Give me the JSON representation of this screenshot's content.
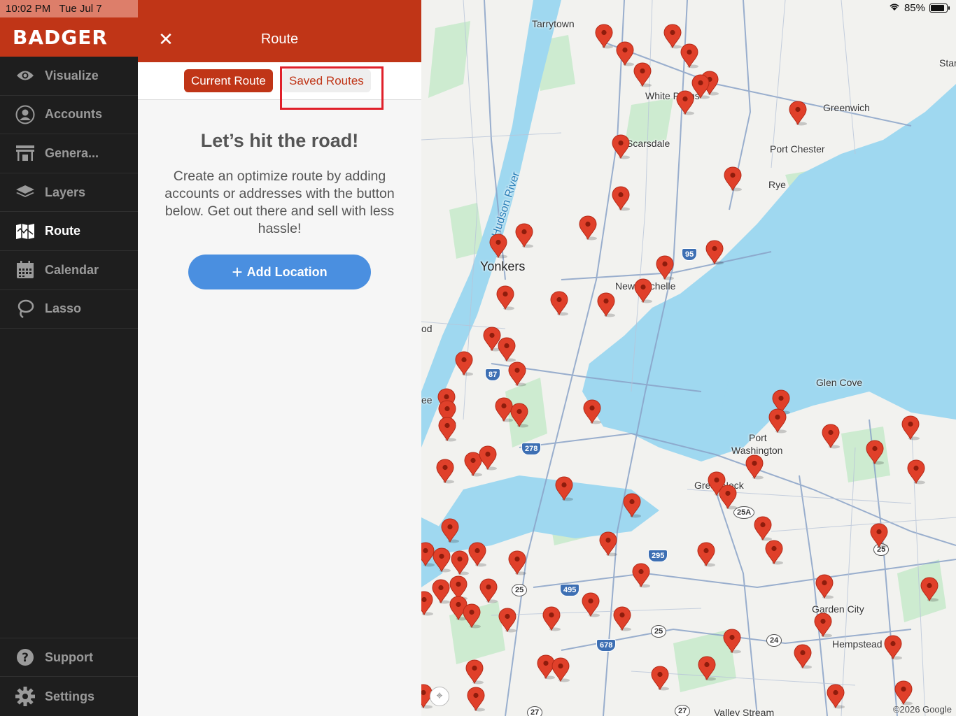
{
  "status_bar": {
    "time": "10:02 PM",
    "date": "Tue Jul 7",
    "battery": "85%"
  },
  "brand": {
    "name": "BADGER"
  },
  "sidebar": {
    "items": [
      {
        "label": "Visualize",
        "icon": "eye-icon"
      },
      {
        "label": "Accounts",
        "icon": "user-circle-icon"
      },
      {
        "label": "Genera...",
        "icon": "storefront-icon"
      },
      {
        "label": "Layers",
        "icon": "layers-icon"
      },
      {
        "label": "Route",
        "icon": "map-icon",
        "active": true
      },
      {
        "label": "Calendar",
        "icon": "calendar-icon"
      },
      {
        "label": "Lasso",
        "icon": "lasso-icon"
      }
    ],
    "bottom_items": [
      {
        "label": "Support",
        "icon": "help-icon"
      },
      {
        "label": "Settings",
        "icon": "gear-icon"
      }
    ]
  },
  "panel": {
    "title": "Route",
    "tabs": {
      "current": "Current Route",
      "saved": "Saved Routes"
    },
    "empty_title": "Let’s hit the road!",
    "empty_text": "Create an optimize route by adding accounts or addresses with the button below. Get out there and sell with less hassle!",
    "add_button": "Add Location"
  },
  "map": {
    "places": [
      "Tarrytown",
      "White Plains",
      "Greenwich",
      "Port Chester",
      "Scarsdale",
      "Rye",
      "Yonkers",
      "New Rochelle",
      "Glen Cove",
      "Port Washington",
      "Great Neck",
      "Garden City",
      "Hempstead",
      "Valley Stream",
      "Hudson River",
      "Star",
      "od",
      "ee"
    ],
    "shields": [
      "95",
      "87",
      "278",
      "295",
      "495",
      "678",
      "25",
      "25A",
      "24",
      "27"
    ],
    "copyright": "©2026 Google",
    "colors": {
      "water": "#9fd8f0",
      "land": "#f2f2ef",
      "park": "#cdebd0",
      "road": "#8aa3c8",
      "pin": "#e0402a"
    }
  }
}
